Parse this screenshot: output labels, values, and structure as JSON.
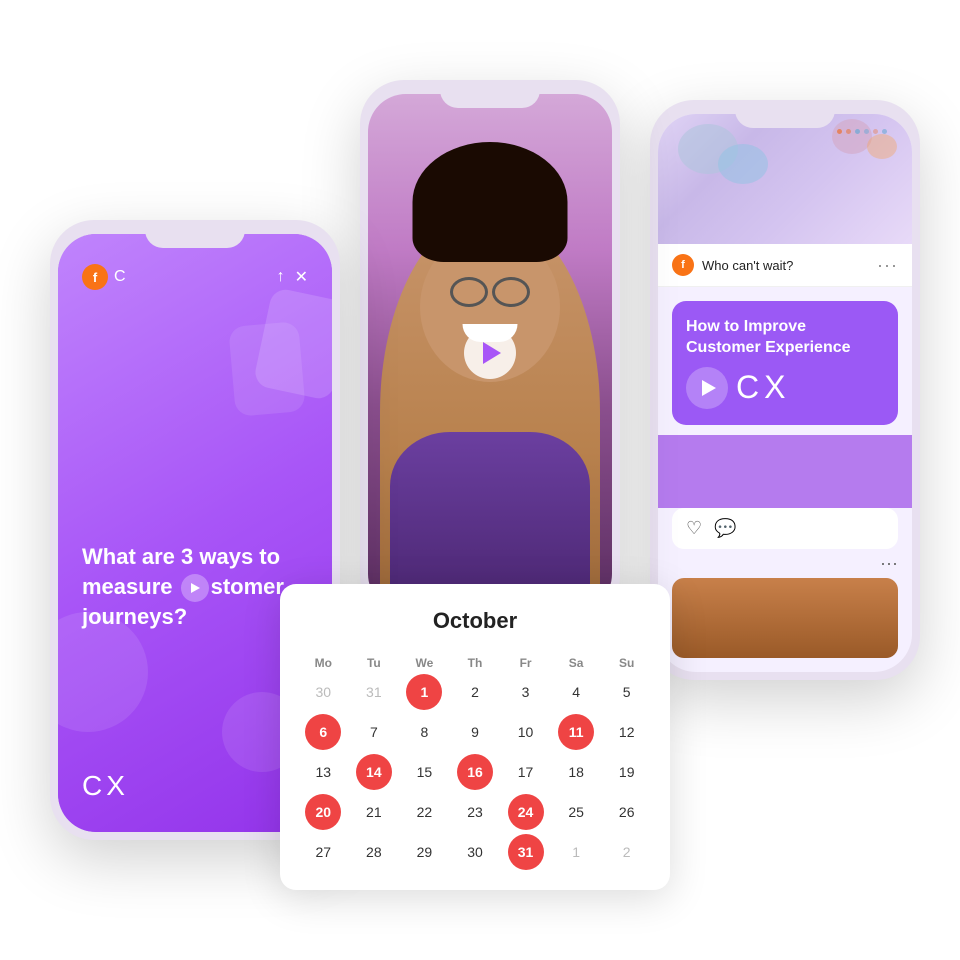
{
  "scene": {
    "background": "#ffffff"
  },
  "left_phone": {
    "logo_letter": "f",
    "main_text": "What are 3 ways to measure customer journeys?",
    "cx_label": "CX",
    "send_label": "send"
  },
  "right_phone": {
    "post_text": "Who can't wait?",
    "cx_card_title": "How to Improve Customer Experience",
    "cx_label": "CX",
    "three_dots": "···",
    "more_dots": "···"
  },
  "calendar": {
    "month": "October",
    "headers": [
      "Mo",
      "Tu",
      "We",
      "Th",
      "Fr",
      "Sa",
      "Su"
    ],
    "weeks": [
      [
        {
          "n": "30",
          "m": true
        },
        {
          "n": "31",
          "m": true
        },
        {
          "n": "1",
          "h": true
        },
        {
          "n": "2"
        },
        {
          "n": "3"
        },
        {
          "n": "4"
        },
        {
          "n": "5"
        }
      ],
      [
        {
          "n": "6",
          "h": true
        },
        {
          "n": "7"
        },
        {
          "n": "8"
        },
        {
          "n": "9"
        },
        {
          "n": "10"
        },
        {
          "n": "11",
          "h": true
        },
        {
          "n": "12"
        }
      ],
      [
        {
          "n": "13"
        },
        {
          "n": "14",
          "h": true
        },
        {
          "n": "15"
        },
        {
          "n": "16",
          "h": true
        },
        {
          "n": "17"
        },
        {
          "n": "18"
        },
        {
          "n": "19"
        }
      ],
      [
        {
          "n": "20",
          "h": true
        },
        {
          "n": "21"
        },
        {
          "n": "22"
        },
        {
          "n": "23"
        },
        {
          "n": "24",
          "h": true
        },
        {
          "n": "25"
        },
        {
          "n": "26"
        }
      ],
      [
        {
          "n": "27"
        },
        {
          "n": "28"
        },
        {
          "n": "29"
        },
        {
          "n": "30"
        },
        {
          "n": "31",
          "h": true
        },
        {
          "n": "1",
          "m": true
        },
        {
          "n": "2",
          "m": true
        }
      ]
    ]
  }
}
